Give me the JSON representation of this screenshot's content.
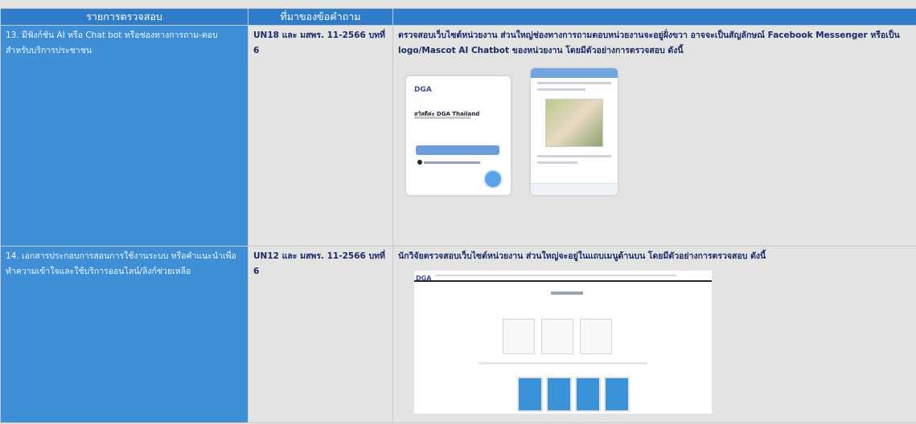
{
  "table": {
    "headers": [
      "รายการตรวจสอบ",
      "ที่มาของข้อคำถาม",
      ""
    ],
    "rows": [
      {
        "item": "13. มีฟังก์ชัน AI หรือ Chat bot หรือช่องทางการถาม-ตอบ สำหรับบริการประชาชน",
        "source": "UN18 และ มสพร. 11-2566 บทที่ 6",
        "description": "ตรวจสอบเว็บไซต์หน่วยงาน ส่วนใหญ่ช่องทางการถามตอบหน่วยงานจะอยู่ฝั่งขวา อาจจะเป็นสัญลักษณ์ Facebook Messenger หรือเป็น logo/Mascot AI Chatbot ของหน่วยงาน โดยมีตัวอย่างการตรวจสอบ ดังนี้"
      },
      {
        "item": "14. เอกสารประกอบการสอนการใช้งานระบบ หรือคำแนะนำเพื่อทำความเข้าใจและใช้บริการออนไลน์/ลิงก์ช่วยเหลือ",
        "source": "UN12 และ มสพร. 11-2566 บทที่ 6",
        "description": "นักวิจัยตรวจสอบเว็บไซต์หน่วยงาน ส่วนใหญ่จะอยู่ในแถบเมนูด้านบน โดยมีตัวอย่างการตรวจสอบ ดังนี้"
      }
    ]
  },
  "chat_mock": {
    "logo": "DGA",
    "greeting": "สวัสดีค่ะ DGA Thailand"
  },
  "web_mock": {
    "logo": "DGA"
  },
  "colors": {
    "header_bg": "#2f7dc8",
    "item_bg": "#3f8fd6",
    "text_dark": "#1a2a6a"
  }
}
